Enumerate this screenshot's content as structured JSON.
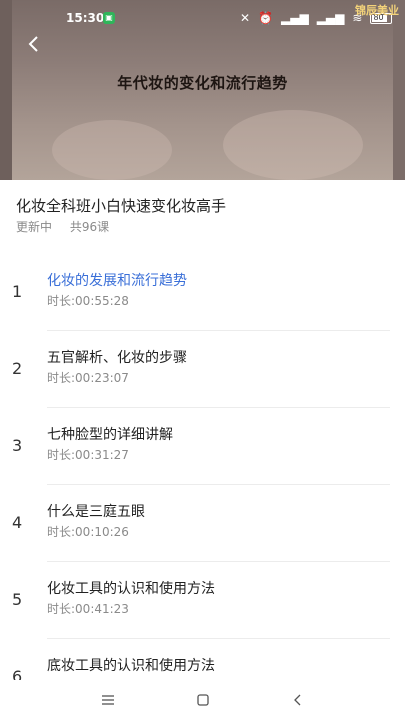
{
  "status_bar": {
    "time": "15:30",
    "battery": "80",
    "logo_text": "锦辰美业"
  },
  "hero": {
    "title": "年代妆的变化和流行趋势"
  },
  "course": {
    "title": "化妆全科班小白快速变化妆高手",
    "status": "更新中",
    "count": "共96课"
  },
  "lessons": [
    {
      "num": "1",
      "name": "化妆的发展和流行趋势",
      "duration": "时长:00:55:28",
      "active": true
    },
    {
      "num": "2",
      "name": "五官解析、化妆的步骤",
      "duration": "时长:00:23:07"
    },
    {
      "num": "3",
      "name": "七种脸型的详细讲解",
      "duration": "时长:00:31:27"
    },
    {
      "num": "4",
      "name": "什么是三庭五眼",
      "duration": "时长:00:10:26"
    },
    {
      "num": "5",
      "name": "化妆工具的认识和使用方法",
      "duration": "时长:00:41:23"
    },
    {
      "num": "6",
      "name": "底妆工具的认识和使用方法",
      "duration": ""
    }
  ],
  "colors": {
    "accent": "#3a6fd8",
    "meta_gray": "#8a8a8a"
  }
}
